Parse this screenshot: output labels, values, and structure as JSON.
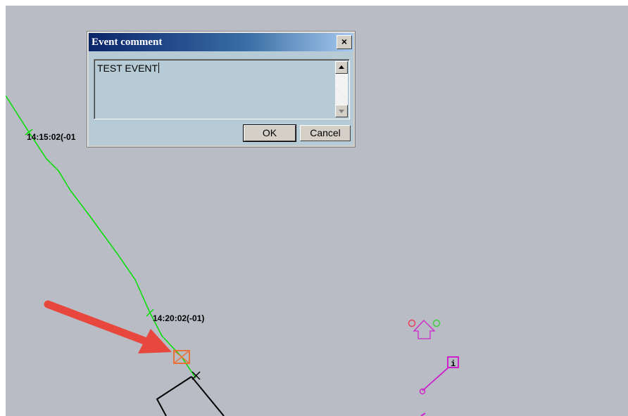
{
  "map": {
    "track_labels": [
      "14:15:02(-01",
      "14:20:02(-01)"
    ],
    "colors": {
      "background": "#b9bcc4",
      "track": "#00e000",
      "event_marker": "#e8743b",
      "annotation_arrow": "#e8473d",
      "magenta_symbol": "#cc22cc"
    }
  },
  "dialog": {
    "title": "Event comment",
    "close_glyph": "×",
    "comment_value": "TEST EVENT",
    "ok_label": "OK",
    "cancel_label": "Cancel"
  },
  "icons": {
    "close": "close-icon",
    "scroll_up": "triangle-up-icon",
    "scroll_down": "triangle-down-icon",
    "event_marker": "boxed-x-icon",
    "info": "info-icon"
  }
}
